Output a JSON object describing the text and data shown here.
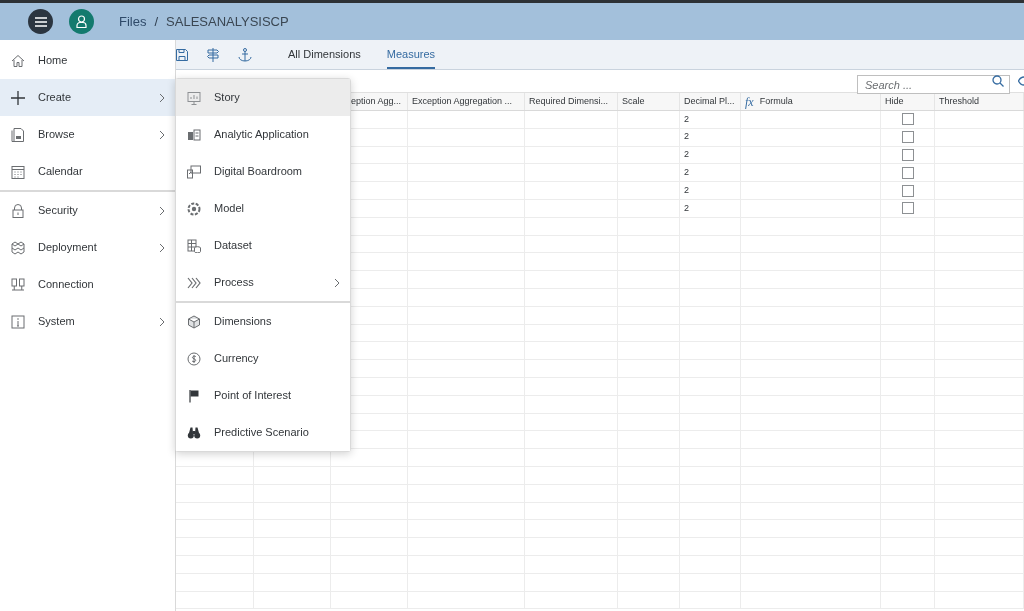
{
  "header": {
    "breadcrumb": [
      "Files",
      "SALESANALYSISCP"
    ],
    "separator": "/"
  },
  "toolbar": {
    "tabs": [
      {
        "label": "All Dimensions",
        "selected": false
      },
      {
        "label": "Measures",
        "selected": true
      }
    ]
  },
  "search": {
    "placeholder": "Search ..."
  },
  "sidebar": {
    "items": [
      {
        "label": "Home",
        "submenu": false,
        "selected": false
      },
      {
        "label": "Create",
        "submenu": true,
        "selected": true
      },
      {
        "label": "Browse",
        "submenu": true,
        "selected": false
      },
      {
        "label": "Calendar",
        "submenu": false,
        "selected": false,
        "divider_after": true
      },
      {
        "label": "Security",
        "submenu": true,
        "selected": false
      },
      {
        "label": "Deployment",
        "submenu": true,
        "selected": false
      },
      {
        "label": "Connection",
        "submenu": false,
        "selected": false
      },
      {
        "label": "System",
        "submenu": true,
        "selected": false
      }
    ]
  },
  "create_menu": {
    "items": [
      {
        "label": "Story",
        "submenu": false,
        "selected": true
      },
      {
        "label": "Analytic Application",
        "submenu": false,
        "selected": false
      },
      {
        "label": "Digital Boardroom",
        "submenu": false,
        "selected": false
      },
      {
        "label": "Model",
        "submenu": false,
        "selected": false
      },
      {
        "label": "Dataset",
        "submenu": false,
        "selected": false
      },
      {
        "label": "Process",
        "submenu": true,
        "selected": false,
        "divider_after": true
      },
      {
        "label": "Dimensions",
        "submenu": false,
        "selected": false
      },
      {
        "label": "Currency",
        "submenu": false,
        "selected": false
      },
      {
        "label": "Point of Interest",
        "submenu": false,
        "selected": false
      },
      {
        "label": "Predictive Scenario",
        "submenu": false,
        "selected": false
      }
    ]
  },
  "table": {
    "columns": [
      {
        "label": "eption Agg..."
      },
      {
        "label": "Exception Aggregation ..."
      },
      {
        "label": "Required Dimensi..."
      },
      {
        "label": "Scale"
      },
      {
        "label": "Decimal Pl..."
      },
      {
        "label": "Formula",
        "prefix": "fx"
      },
      {
        "label": "Hide"
      },
      {
        "label": "Threshold"
      }
    ],
    "rows": [
      {
        "decimal_places": "2",
        "hide": false
      },
      {
        "decimal_places": "2",
        "hide": false
      },
      {
        "decimal_places": "2",
        "hide": false
      },
      {
        "decimal_places": "2",
        "hide": false
      },
      {
        "decimal_places": "2",
        "hide": false
      },
      {
        "decimal_places": "2",
        "hide": false
      }
    ]
  }
}
